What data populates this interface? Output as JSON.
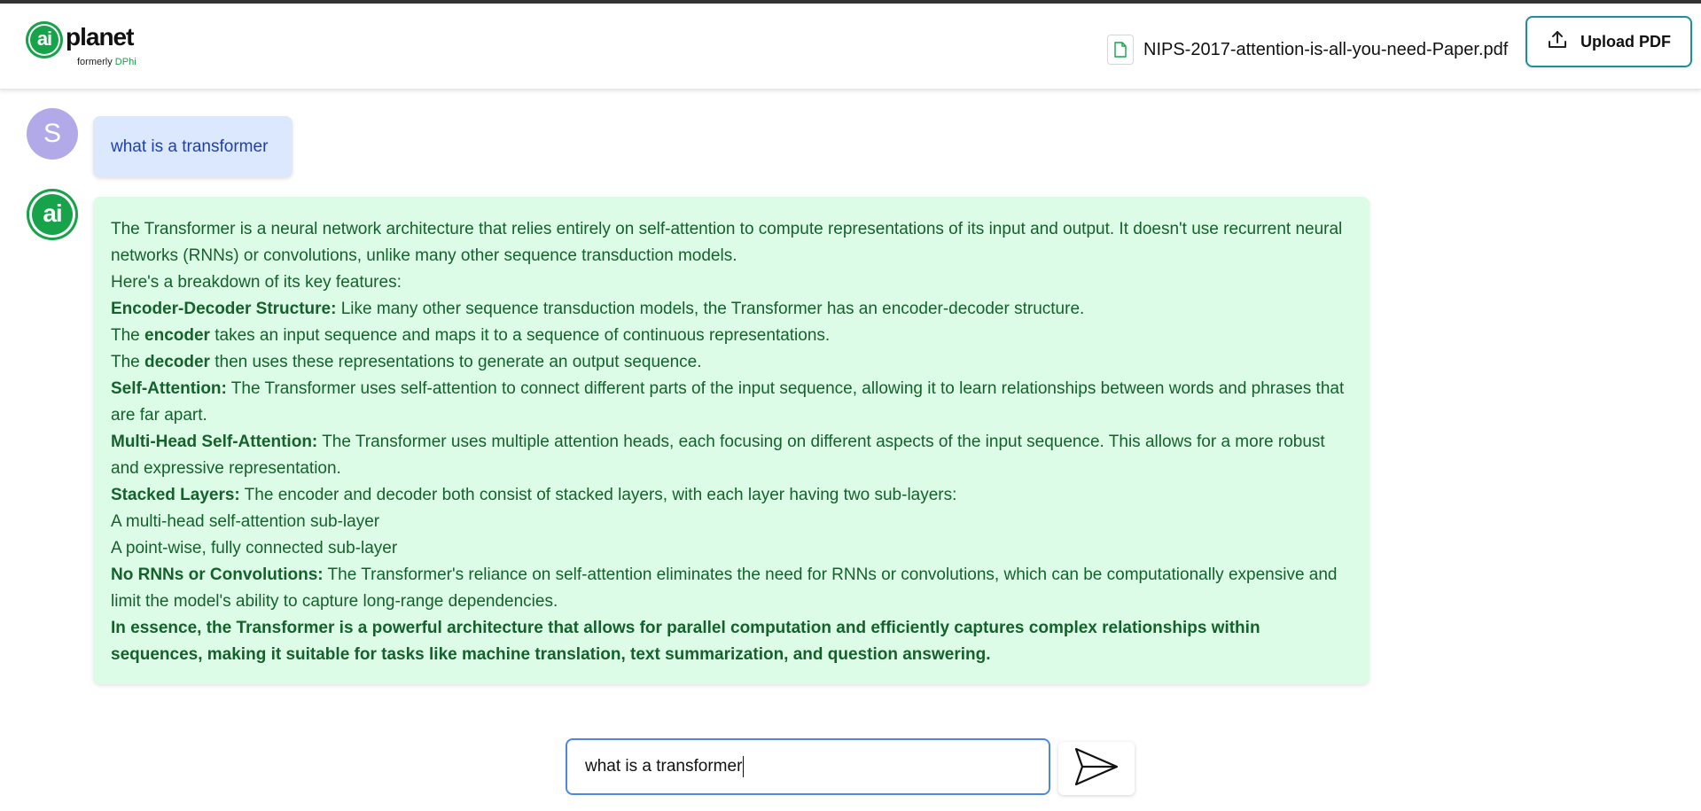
{
  "header": {
    "logo_mark": "ai",
    "logo_word": "planet",
    "logo_sub_prefix": "formerly",
    "logo_sub_brand": "DPhi",
    "file_name": "NIPS-2017-attention-is-all-you-need-Paper.pdf",
    "upload_label": "Upload PDF"
  },
  "chat": {
    "user_initial": "S",
    "user_message": "what is a transformer",
    "ai_initial": "ai",
    "ai_response": [
      {
        "bold": "",
        "text": "The Transformer is a neural network architecture that relies entirely on self-attention to compute representations of its input and output. It doesn't use recurrent neural networks (RNNs) or convolutions, unlike many other sequence transduction models."
      },
      {
        "bold": "",
        "text": "Here's a breakdown of its key features:"
      },
      {
        "bold": "Encoder-Decoder Structure:",
        "text": " Like many other sequence transduction models, the Transformer has an encoder-decoder structure."
      },
      {
        "pre": "The ",
        "bold": "encoder",
        "text": " takes an input sequence and maps it to a sequence of continuous representations."
      },
      {
        "pre": "The ",
        "bold": "decoder",
        "text": " then uses these representations to generate an output sequence."
      },
      {
        "bold": "Self-Attention:",
        "text": " The Transformer uses self-attention to connect different parts of the input sequence, allowing it to learn relationships between words and phrases that are far apart."
      },
      {
        "bold": "Multi-Head Self-Attention:",
        "text": " The Transformer uses multiple attention heads, each focusing on different aspects of the input sequence. This allows for a more robust and expressive representation."
      },
      {
        "bold": "Stacked Layers:",
        "text": " The encoder and decoder both consist of stacked layers, with each layer having two sub-layers:"
      },
      {
        "bold": "",
        "text": "A multi-head self-attention sub-layer"
      },
      {
        "bold": "",
        "text": "A point-wise, fully connected sub-layer"
      },
      {
        "bold": "No RNNs or Convolutions:",
        "text": " The Transformer's reliance on self-attention eliminates the need for RNNs or convolutions, which can be computationally expensive and limit the model's ability to capture long-range dependencies."
      },
      {
        "bold": "In essence, the Transformer is a powerful architecture that allows for parallel computation and efficiently captures complex relationships within sequences, making it suitable for tasks like machine translation, text summarization, and question answering.",
        "text": ""
      }
    ]
  },
  "composer": {
    "input_value": "what is a transformer",
    "send_icon": "send-icon"
  },
  "colors": {
    "brand_green": "#17a34a",
    "user_bubble": "#dbe8fe",
    "ai_bubble": "#dcfce7",
    "ai_text": "#15612c",
    "input_border": "#4f86e6",
    "upload_border": "#1f8e9a"
  }
}
